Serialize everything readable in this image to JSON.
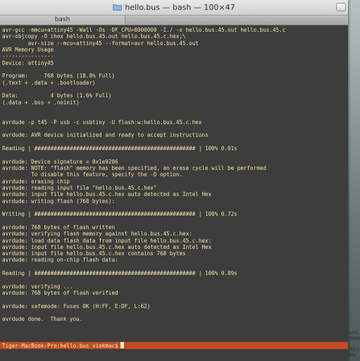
{
  "window": {
    "title": "hello.bus — bash — 100×47",
    "tab_label": "bash"
  },
  "terminal": {
    "lines": [
      "avr-gcc -mmcu=attiny45 -Wall -Os -DF_CPU=8000000 -I./ -o hello.bus.45.out hello.bus.45.c",
      "avr-objcopy -O ihex hello.bus.45.out hello.bus.45.c.hex;\\",
      "        avr-size --mcu=attiny45 --format=avr hello.bus.45.out",
      "AVR Memory Usage",
      "----------------",
      "Device: attiny45",
      "",
      "Program:     768 bytes (18.8% Full)",
      "(.text + .data + .bootloader)",
      "",
      "Data:          4 bytes (1.6% Full)",
      "(.data + .bss + .noinit)",
      "",
      "",
      "avrdude -p t45 -P usb -c usbtiny -U flash:w:hello.bus.45.c.hex",
      "",
      "avrdude: AVR device initialized and ready to accept instructions",
      "",
      "Reading | ################################################## | 100% 0.01s",
      "",
      "avrdude: Device signature = 0x1e9206",
      "avrdude: NOTE: \"flash\" memory has been specified, an erase cycle will be performed",
      "         To disable this feature, specify the -D option.",
      "avrdude: erasing chip",
      "avrdude: reading input file \"hello.bus.45.c.hex\"",
      "avrdude: input file hello.bus.45.c.hex auto detected as Intel Hex",
      "avrdude: writing flash (768 bytes):",
      "",
      "Writing | ################################################## | 100% 0.72s",
      "",
      "avrdude: 768 bytes of flash written",
      "avrdude: verifying flash memory against hello.bus.45.c.hex:",
      "avrdude: load data flash data from input file hello.bus.45.c.hex:",
      "avrdude: input file hello.bus.45.c.hex auto detected as Intel Hex",
      "avrdude: input file hello.bus.45.c.hex contains 768 bytes",
      "avrdude: reading on-chip flash data:",
      "",
      "Reading | ################################################## | 100% 0.89s",
      "",
      "avrdude: verifying ...",
      "avrdude: 768 bytes of flash verified",
      "",
      "avrdude: safemode: Fuses OK (H:FF, E:DF, L:62)",
      "",
      "avrdude done.  Thank you.",
      ""
    ],
    "prompt": "Tiger-MacBook-Pro:hello.bus viokmac$"
  },
  "desktop": {
    "fragments": [
      "UAL",
      "tted",
      "RESSI",
      "Ha"
    ]
  },
  "colors": {
    "terminal_bg": "#3d3d3d",
    "terminal_text": "#f4e4a6",
    "prompt_bar": "#c24a22"
  }
}
